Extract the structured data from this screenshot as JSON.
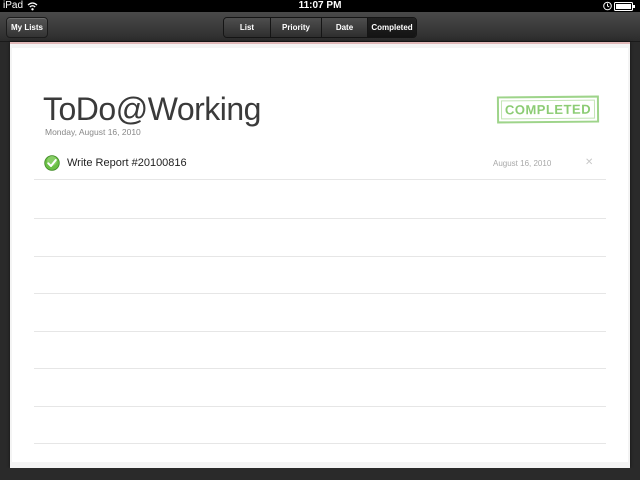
{
  "status_bar": {
    "device": "iPad",
    "time": "11:07 PM"
  },
  "toolbar": {
    "back_label": "My Lists",
    "segments": [
      "List",
      "Priority",
      "Date",
      "Completed"
    ],
    "active_segment": "Completed"
  },
  "list": {
    "title": "ToDo@Working",
    "date": "Monday, August 16, 2010",
    "stamp": "COMPLETED",
    "tasks": [
      {
        "label": "Write Report #20100816",
        "date": "August 16, 2010",
        "completed": true
      }
    ]
  },
  "colors": {
    "stamp_green": "#8ccc74",
    "check_green": "#5cb03a",
    "toolbar_dark": "#2c2c2c"
  },
  "icons": [
    "wifi-icon",
    "lock-icon",
    "battery-icon",
    "check-icon",
    "delete-icon"
  ]
}
